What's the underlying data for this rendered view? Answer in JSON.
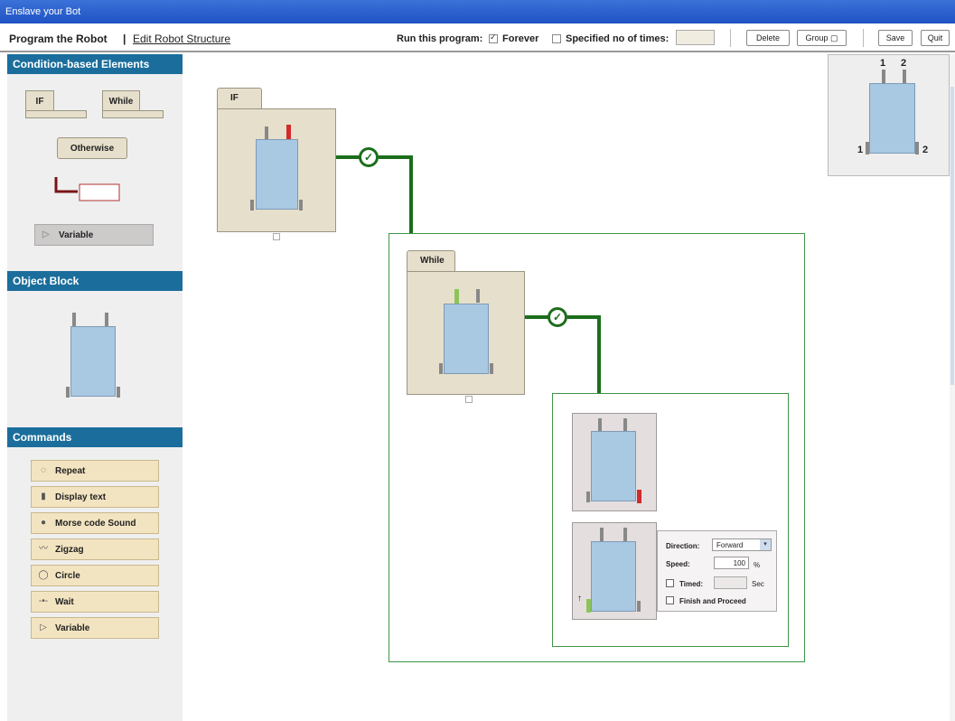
{
  "window": {
    "title": "Enslave your Bot"
  },
  "header": {
    "title": "Program the Robot",
    "separator": "|",
    "edit_link": "Edit Robot Structure",
    "run_label": "Run this program:",
    "forever_label": "Forever",
    "forever_checked": true,
    "specified_label": "Specified no of times:",
    "specified_checked": false,
    "specified_value": "",
    "buttons": {
      "delete": "Delete",
      "group": "Group ▢",
      "save": "Save",
      "quit": "Quit"
    }
  },
  "sidebar": {
    "condition_section": {
      "title": "Condition-based Elements",
      "if_label": "IF",
      "while_label": "While",
      "otherwise_label": "Otherwise",
      "variable_label": "Variable"
    },
    "object_section": {
      "title": "Object Block"
    },
    "commands_section": {
      "title": "Commands",
      "items": [
        {
          "label": "Repeat",
          "icon": "repeat-icon",
          "glyph": "◌"
        },
        {
          "label": "Display text",
          "icon": "display-text-icon",
          "glyph": "▮"
        },
        {
          "label": "Morse code Sound",
          "icon": "bulb-icon",
          "glyph": "●"
        },
        {
          "label": "Zigzag",
          "icon": "zigzag-icon",
          "glyph": "〰"
        },
        {
          "label": "Circle",
          "icon": "circle-icon",
          "glyph": "◯"
        },
        {
          "label": "Wait",
          "icon": "wait-icon",
          "glyph": "-•-"
        },
        {
          "label": "Variable",
          "icon": "variable-icon",
          "glyph": "▷"
        }
      ]
    }
  },
  "canvas": {
    "if_block_label": "IF",
    "while_block_label": "While",
    "check_glyph": "✓",
    "options": {
      "direction_label": "Direction:",
      "direction_value": "Forward",
      "speed_label": "Speed:",
      "speed_value": "100",
      "speed_unit": "%",
      "timed_label": "Timed:",
      "timed_unit": "Sec",
      "timed_checked": false,
      "finish_label": "Finish and Proceed",
      "finish_checked": false,
      "dropdown_arrow": "▾",
      "motor_arrow": "↑"
    },
    "preview": {
      "top_left": "1",
      "top_right": "2",
      "side_left": "1",
      "side_right": "2"
    }
  },
  "colors": {
    "titlebar": "#2a5fd0",
    "section_header": "#1b6e9c",
    "block_bg": "#e6dfcb",
    "command_bg": "#f3e4c1",
    "robot_body": "#a9c8e2",
    "connector": "#1b6e1b",
    "frame_border": "#3e9648",
    "active_red": "#d22a2a",
    "active_green": "#8cc45a"
  }
}
